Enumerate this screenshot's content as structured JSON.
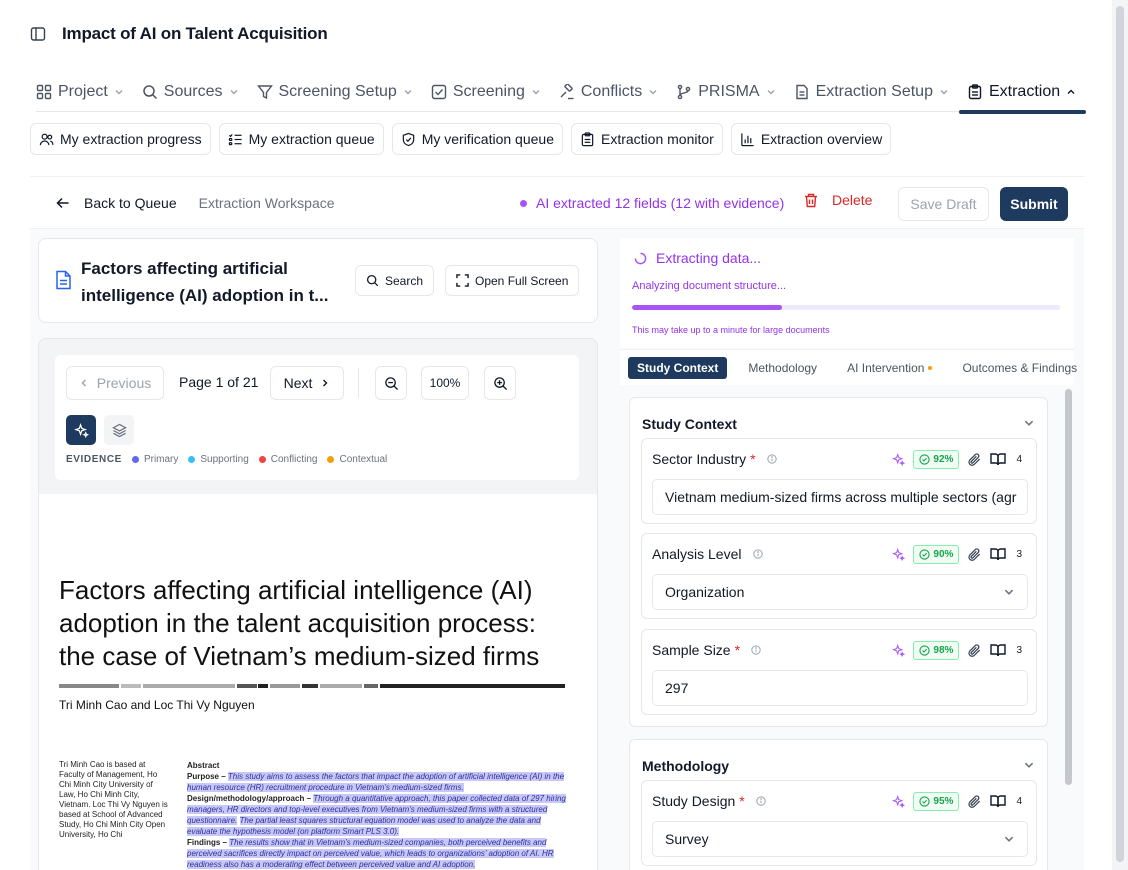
{
  "header": {
    "title": "Impact of AI on Talent Acquisition"
  },
  "nav_tabs": [
    {
      "label": "Project",
      "icon": "grid-icon"
    },
    {
      "label": "Sources",
      "icon": "search-icon"
    },
    {
      "label": "Screening Setup",
      "icon": "filter-icon"
    },
    {
      "label": "Screening",
      "icon": "checkbox-icon"
    },
    {
      "label": "Conflicts",
      "icon": "gavel-icon"
    },
    {
      "label": "PRISMA",
      "icon": "branch-icon"
    },
    {
      "label": "Extraction Setup",
      "icon": "document-icon"
    },
    {
      "label": "Extraction",
      "icon": "clipboard-icon",
      "active": true
    }
  ],
  "sub_tabs": [
    {
      "label": "My extraction progress",
      "icon": "users-icon"
    },
    {
      "label": "My extraction queue",
      "icon": "list-icon"
    },
    {
      "label": "My verification queue",
      "icon": "shield-check-icon"
    },
    {
      "label": "Extraction monitor",
      "icon": "clipboard-icon"
    },
    {
      "label": "Extraction overview",
      "icon": "bar-chart-icon"
    }
  ],
  "workspace": {
    "back_label": "Back to Queue",
    "workspace_label": "Extraction Workspace",
    "ai_status": "AI extracted 12 fields (12 with evidence)",
    "delete_label": "Delete",
    "save_draft_label": "Save Draft",
    "submit_label": "Submit"
  },
  "document": {
    "title": "Factors affecting artificial intelligence (AI) adoption in t...",
    "search_label": "Search",
    "fullscreen_label": "Open Full Screen"
  },
  "viewer": {
    "previous_label": "Previous",
    "page_indicator": "Page 1 of 21",
    "next_label": "Next",
    "zoom": "100%",
    "evidence_label": "EVIDENCE",
    "legend": [
      {
        "label": "Primary",
        "color": "#6366f1"
      },
      {
        "label": "Supporting",
        "color": "#38bdf8"
      },
      {
        "label": "Conflicting",
        "color": "#ef4444"
      },
      {
        "label": "Contextual",
        "color": "#f59e0b"
      }
    ]
  },
  "paper": {
    "title": "Factors affecting artificial intelligence (AI) adoption in the talent acquisition process: the case of Vietnam’s medium-sized firms",
    "authors": "Tri Minh Cao and Loc Thi Vy Nguyen",
    "sidebar_text": "Tri Minh Cao is based at Faculty of Management, Ho Chi Minh City University of Law, Ho Chi Minh City, Vietnam. Loc Thi Vy Nguyen is based at School of Advanced Study, Ho Chi Minh City Open University, Ho Chi",
    "abstract_heading": "Abstract",
    "purpose_heading": "Purpose –",
    "purpose_text": "This study aims to assess the factors that impact the adoption of artificial intelligence (AI) in the human resource (HR) recruitment procedure in Vietnam’s medium-sized firms.",
    "design_heading": "Design/methodology/approach –",
    "design_text_1": "Through a quantitative approach, this paper collected data of 297 hiring managers, HR directors and top-level executives from Vietnam’s medium-sized firms with a structured questionnaire.",
    "design_text_2": "The partial least squares structural equation model was used to analyze the data and evaluate the hypothesis model (on platform Smart PLS 3.0).",
    "findings_heading": "Findings –",
    "findings_text": "The results show that in Vietnam’s medium-sized companies, both perceived benefits and perceived sacrifices directly impact on perceived value, which leads to organizations’ adoption of AI. HR readiness also has a moderating effect between perceived value and AI adoption."
  },
  "extraction": {
    "title": "Extracting data...",
    "subtitle": "Analyzing document structure...",
    "progress": 0.35,
    "note": "This may take up to a minute for large documents"
  },
  "section_tabs": [
    {
      "label": "Study Context",
      "active": true
    },
    {
      "label": "Methodology"
    },
    {
      "label": "AI Intervention",
      "dot": true
    },
    {
      "label": "Outcomes & Findings"
    }
  ],
  "sections": {
    "study_context": {
      "title": "Study Context",
      "fields": [
        {
          "label": "Sector Industry",
          "required": true,
          "confidence": "92%",
          "evidence_count": "4",
          "value": "Vietnam medium-sized firms across multiple sectors (agr",
          "type": "text"
        },
        {
          "label": "Analysis Level",
          "required": false,
          "confidence": "90%",
          "evidence_count": "3",
          "value": "Organization",
          "type": "select"
        },
        {
          "label": "Sample Size",
          "required": true,
          "confidence": "98%",
          "evidence_count": "3",
          "value": "297",
          "type": "text"
        }
      ]
    },
    "methodology": {
      "title": "Methodology",
      "fields": [
        {
          "label": "Study Design",
          "required": true,
          "confidence": "95%",
          "evidence_count": "4",
          "value": "Survey",
          "type": "select"
        }
      ]
    }
  },
  "required_mark": "*",
  "colors": {
    "brand": "#1e3a5f",
    "ai": "#9333ea",
    "danger": "#dc2626",
    "success": "#16a34a"
  }
}
